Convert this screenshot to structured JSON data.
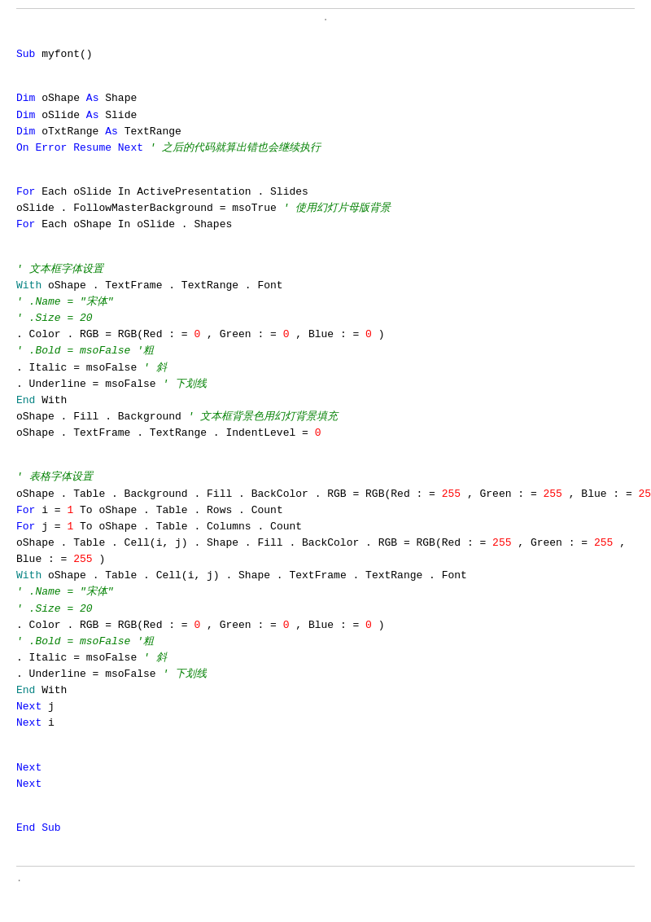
{
  "page": {
    "top_dot": ".",
    "bottom_dot": ".",
    "lines": []
  }
}
